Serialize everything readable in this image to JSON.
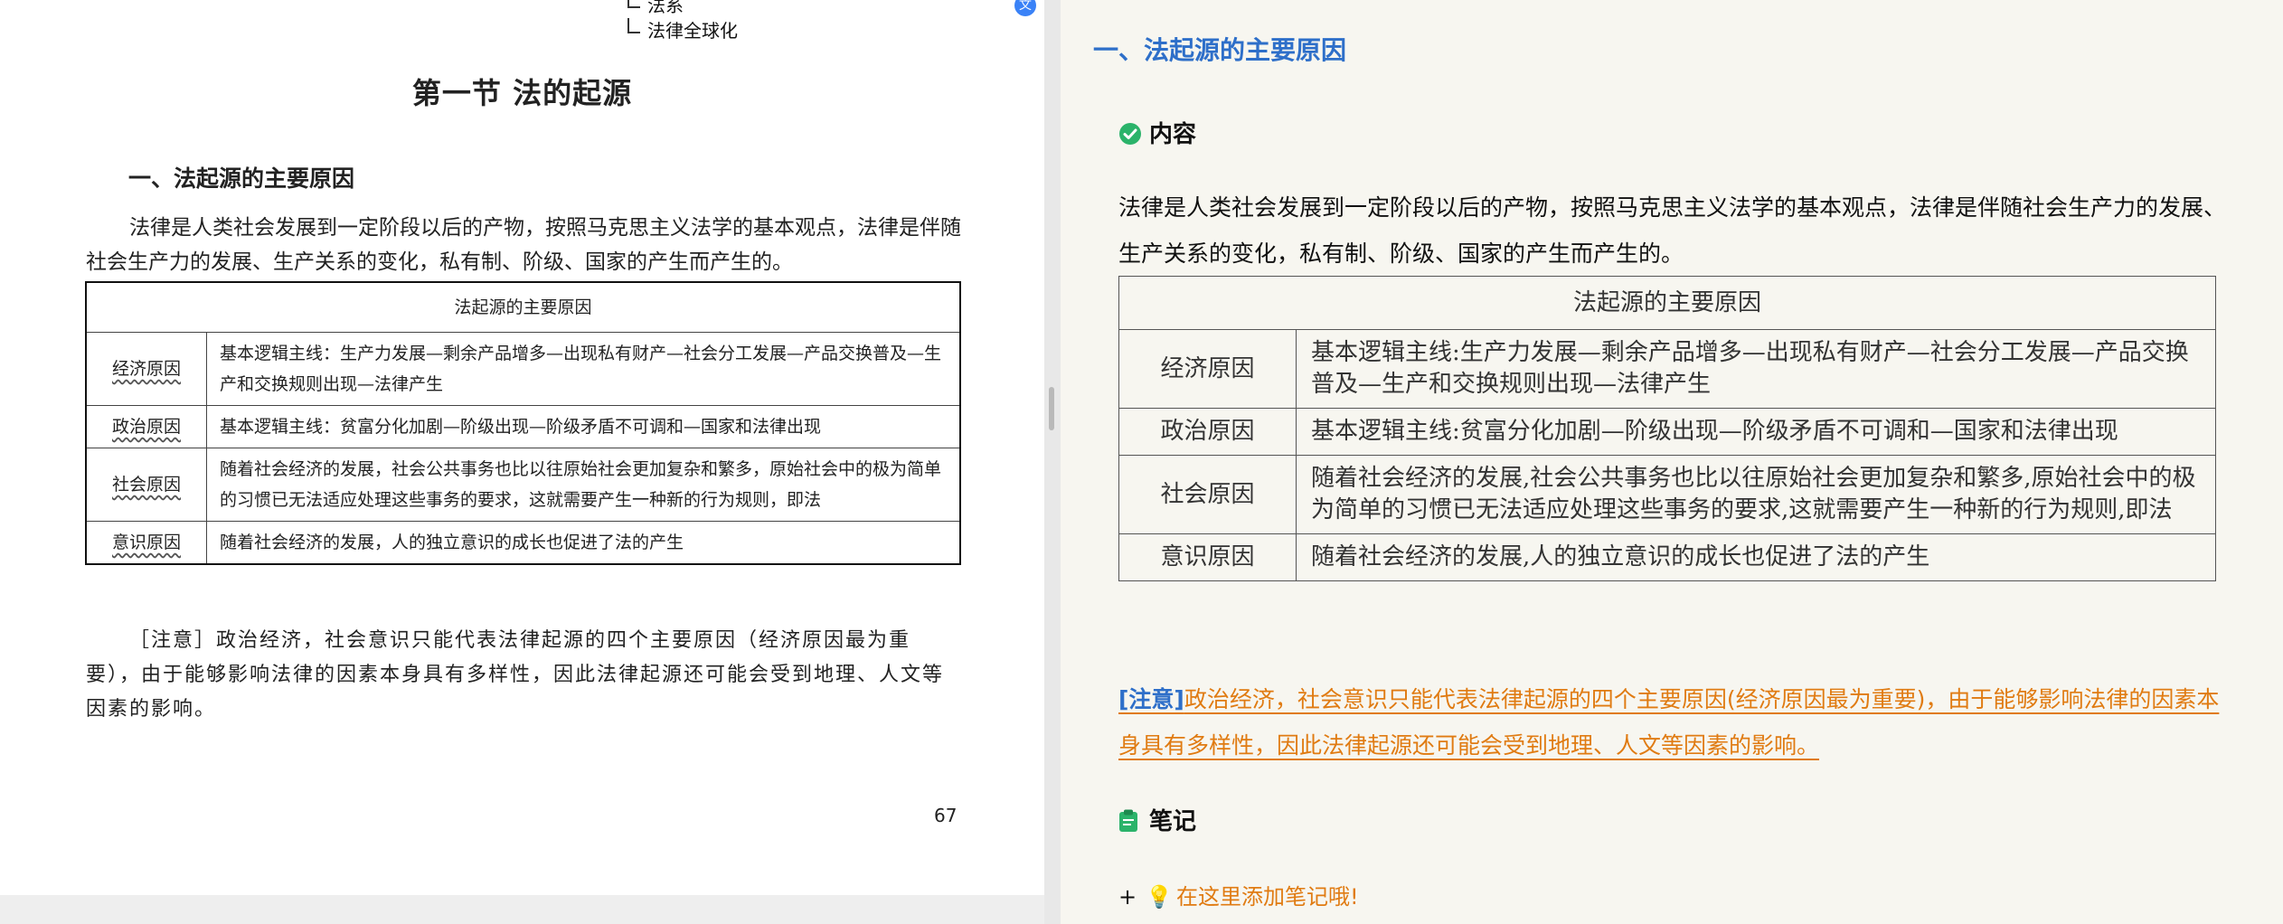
{
  "pdf": {
    "outline_items": [
      "法系",
      "法律全球化"
    ],
    "section_title": "第一节    法的起源",
    "heading": "一、法起源的主要原因",
    "paragraph": "法律是人类社会发展到一定阶段以后的产物，按照马克思主义法学的基本观点，法律是伴随社会生产力的发展、生产关系的变化，私有制、阶级、国家的产生而产生的。",
    "table": {
      "header": "法起源的主要原因",
      "rows": [
        {
          "category": "经济原因",
          "text": "基本逻辑主线：生产力发展—剩余产品增多—出现私有财产—社会分工发展—产品交换普及—生产和交换规则出现—法律产生"
        },
        {
          "category": "政治原因",
          "text": "基本逻辑主线：贫富分化加剧—阶级出现—阶级矛盾不可调和—国家和法律出现"
        },
        {
          "category": "社会原因",
          "text": "随着社会经济的发展，社会公共事务也比以往原始社会更加复杂和繁多，原始社会中的极为简单的习惯已无法适应处理这些事务的要求，这就需要产生一种新的行为规则，即法"
        },
        {
          "category": "意识原因",
          "text": "随着社会经济的发展，人的独立意识的成长也促进了法的产生"
        }
      ]
    },
    "note": "［注意］政治经济，社会意识只能代表法律起源的四个主要原因（经济原因最为重要），由于能够影响法律的因素本身具有多样性，因此法律起源还可能会受到地理、人文等因素的影响。",
    "page_number": "67"
  },
  "notes": {
    "title": "一、法起源的主要原因",
    "content_heading": "内容",
    "paragraph": "法律是人类社会发展到一定阶段以后的产物，按照马克思主义法学的基本观点，法律是伴随社会生产力的发展、生产关系的变化，私有制、阶级、国家的产生而产生的。",
    "table": {
      "header": "法起源的主要原因",
      "rows": [
        {
          "category": "经济原因",
          "text": "基本逻辑主线:生产力发展—剩余产品增多—出现私有财产—社会分工发展—产品交换普及—生产和交换规则出现—法律产生"
        },
        {
          "category": "政治原因",
          "text": "基本逻辑主线:贫富分化加剧—阶级出现—阶级矛盾不可调和—国家和法律出现"
        },
        {
          "category": "社会原因",
          "text": "随着社会经济的发展,社会公共事务也比以往原始社会更加复杂和繁多,原始社会中的极为简单的习惯已无法适应处理这些事务的要求,这就需要产生一种新的行为规则,即法"
        },
        {
          "category": "意识原因",
          "text": "随着社会经济的发展,人的独立意识的成长也促进了法的产生"
        }
      ]
    },
    "note_tag": "[注意]",
    "note_text": "政治经济，社会意识只能代表法律起源的四个主要原因(经济原因最为重要)，由于能够影响法律的因素本身具有多样性，因此法律起源还可能会受到地理、人文等因素的影响。",
    "notes_heading": "笔记",
    "add_note_plus": "+",
    "add_note_text": "在这里添加笔记哦!"
  },
  "colors": {
    "title_blue": "#2e6fc9",
    "highlight_orange": "#e07b12",
    "check_green": "#2bb36a",
    "notes_bg": "#f7f6f0"
  },
  "icons": {
    "content": "check-circle-icon",
    "notes": "clipboard-icon",
    "add": "lightbulb-icon"
  }
}
